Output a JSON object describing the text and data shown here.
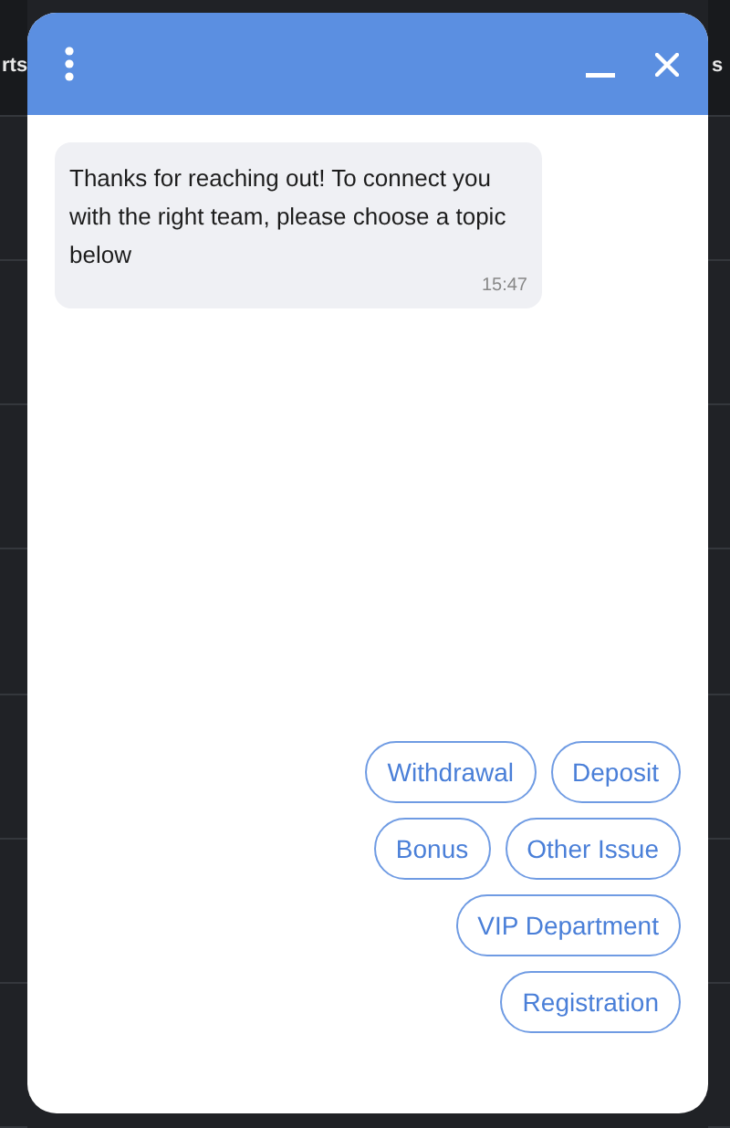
{
  "background": {
    "left_text": "rts",
    "right_text": "s"
  },
  "chat": {
    "message": {
      "text": "Thanks for reaching out! To connect you with the right team, please choose a topic below",
      "time": "15:47"
    },
    "topic_rows": [
      [
        "Withdrawal",
        "Deposit"
      ],
      [
        "Bonus",
        "Other Issue"
      ],
      [
        "VIP Department"
      ],
      [
        "Registration"
      ]
    ]
  }
}
